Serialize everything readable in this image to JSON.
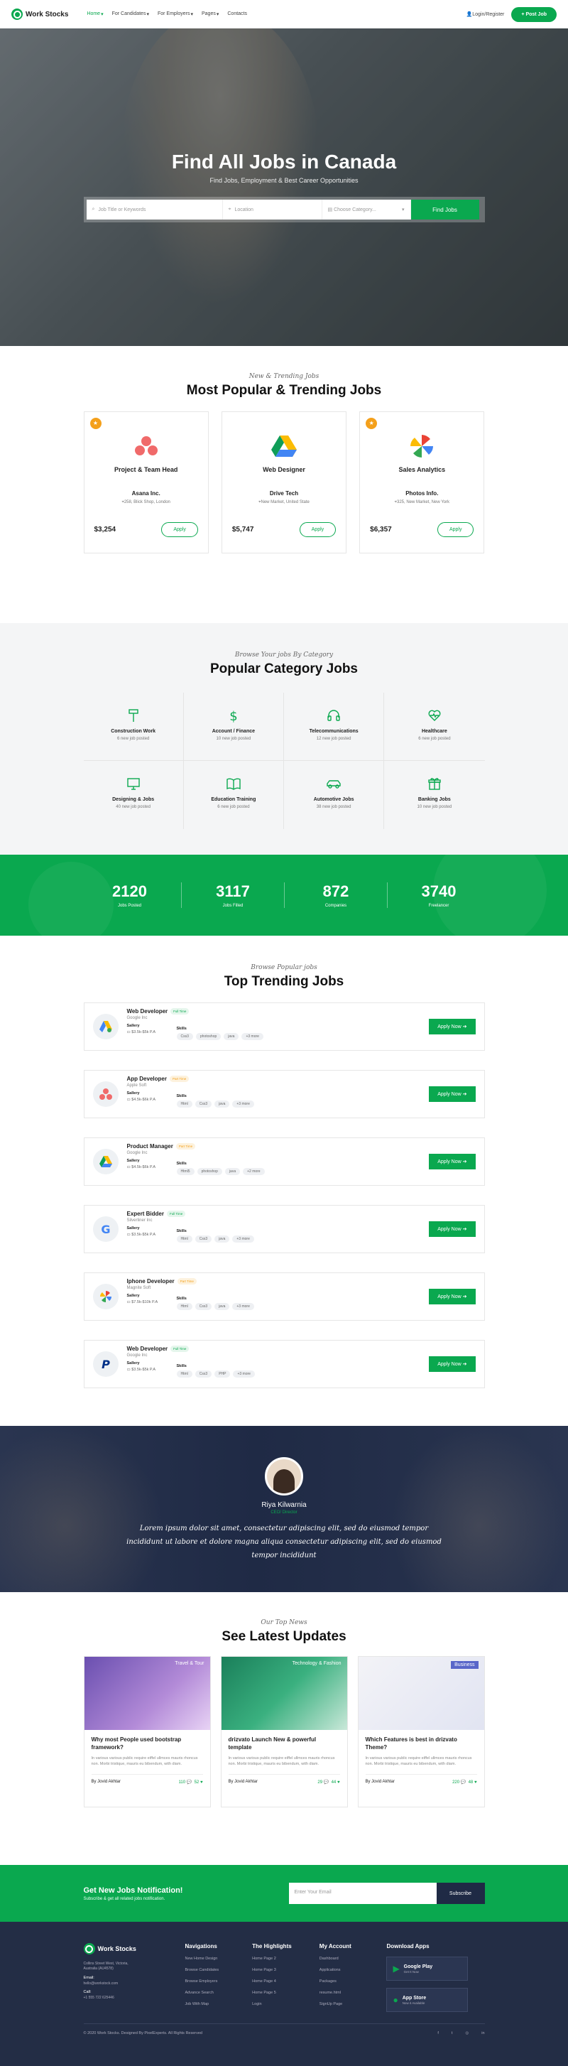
{
  "nav": {
    "brand": "Work Stocks",
    "items": [
      "Home",
      "For Candidates",
      "For Employers",
      "Pages",
      "Contacts"
    ],
    "login": "Login/Register",
    "post_job": "Post Job"
  },
  "hero": {
    "title": "Find All Jobs in Canada",
    "subtitle": "Find Jobs, Employment & Best Career Opportunities",
    "search_placeholder": "Job Title or Keywords",
    "location_placeholder": "Location",
    "category_placeholder": "Choose Category...",
    "button": "Find Jobs"
  },
  "popular": {
    "kicker": "New & Trending Jobs",
    "title": "Most Popular & Trending Jobs",
    "cards": [
      {
        "role": "Project & Team Head",
        "company": "Asana Inc.",
        "location": "258, Blick Shop, London",
        "price": "$3,254",
        "apply": "Apply"
      },
      {
        "role": "Web Designer",
        "company": "Drive Tech",
        "location": "New Market, United State",
        "price": "$5,747",
        "apply": "Apply"
      },
      {
        "role": "Sales Analytics",
        "company": "Photos Info.",
        "location": "325, New Market, New York",
        "price": "$6,357",
        "apply": "Apply"
      }
    ]
  },
  "category": {
    "kicker": "Browse Your jobs By Category",
    "title": "Popular Category Jobs",
    "items": [
      {
        "name": "Construction Work",
        "count": "6 new job posted",
        "icon": "hammer-icon"
      },
      {
        "name": "Account / Finance",
        "count": "10 new job posted",
        "icon": "dollar-icon"
      },
      {
        "name": "Telecommunications",
        "count": "12 new job posted",
        "icon": "headset-icon"
      },
      {
        "name": "Healthcare",
        "count": "6 new job posted",
        "icon": "heartbeat-icon"
      },
      {
        "name": "Designing & Jobs",
        "count": "40 new job posted",
        "icon": "monitor-icon"
      },
      {
        "name": "Education Training",
        "count": "6 new job posted",
        "icon": "book-icon"
      },
      {
        "name": "Automotive Jobs",
        "count": "38 new job posted",
        "icon": "car-icon"
      },
      {
        "name": "Banking Jobs",
        "count": "10 new job posted",
        "icon": "gift-icon"
      }
    ]
  },
  "stats": [
    {
      "num": "2120",
      "label": "Jobs Posted"
    },
    {
      "num": "3117",
      "label": "Jobs Filled"
    },
    {
      "num": "872",
      "label": "Companies"
    },
    {
      "num": "3740",
      "label": "Freelancer"
    }
  ],
  "trending": {
    "kicker": "Browse Popular jobs",
    "title": "Top Trending Jobs",
    "salary_label": "Sallery",
    "skills_label": "Skills",
    "apply": "Apply Now",
    "jobs": [
      {
        "title": "Web Developer",
        "badge": "Full Time",
        "badge_type": "full",
        "company": "Google Inc",
        "salary": "$3.5k-$5k P.A",
        "skills": [
          "Css3",
          "photoshop",
          "java",
          "+3 more"
        ]
      },
      {
        "title": "App Developer",
        "badge": "Part Time",
        "badge_type": "free",
        "company": "Apple Soft",
        "salary": "$4.5k-$6k P.A",
        "skills": [
          "Html",
          "Css3",
          "java",
          "+3 more"
        ]
      },
      {
        "title": "Product Manager",
        "badge": "Part Time",
        "badge_type": "free",
        "company": "Google Inc",
        "salary": "$4.5k-$6k P.A",
        "skills": [
          "Html5",
          "photoshop",
          "java",
          "+2 more"
        ]
      },
      {
        "title": "Expert Bidder",
        "badge": "Full Time",
        "badge_type": "full",
        "company": "Silverliner Inc",
        "salary": "$3.5k-$5k P.A",
        "skills": [
          "Html",
          "Css3",
          "java",
          "+3 more"
        ]
      },
      {
        "title": "Iphone Developer",
        "badge": "Part Time",
        "badge_type": "free",
        "company": "Magnite Soft",
        "salary": "$7.5k-$10k P.A",
        "skills": [
          "Html",
          "Css3",
          "java",
          "+3 more"
        ]
      },
      {
        "title": "Web Developer",
        "badge": "Full Time",
        "badge_type": "full",
        "company": "Google Inc",
        "salary": "$3.5k-$5k P.A",
        "skills": [
          "Html",
          "Css3",
          "PHP",
          "+3 more"
        ]
      }
    ]
  },
  "testimonial": {
    "name": "Riya Kilwarnia",
    "role": "CEO/ Director",
    "quote": "Lorem ipsum dolor sit amet, consectetur adipiscing elit, sed do eiusmod tempor incididunt ut labore et dolore magna aliqua consectetur adipiscing elit, sed do eiusmod tempor incididunt"
  },
  "blog": {
    "kicker": "Our Top News",
    "title": "See Latest Updates",
    "posts": [
      {
        "label": "Travel & Tour",
        "title": "Why most People used bootstrap framework?",
        "text": "In various various public require eiffel ullmces mauris rhoncus non. Morbi tristique, mauris eu bibendum, with diam.",
        "author": "By Jovid Akhtar",
        "comments": "110",
        "likes": "52"
      },
      {
        "label": "Technology & Fashion",
        "title": "drizvato Launch New & powerful template",
        "text": "In various various public require eiffel ullmces mauris rhoncus non. Morbi tristique, mauris eu bibendum, with diam.",
        "author": "By Jovid Akhtar",
        "comments": "29",
        "likes": "44"
      },
      {
        "label": "Business",
        "title": "Which Features is best in drizvato Theme?",
        "text": "In various various public require eiffel ullmces mauris rhoncus non. Morbi tristique, mauris eu bibendum, with diam.",
        "author": "By Jovid Akhtar",
        "comments": "220",
        "likes": "48"
      }
    ]
  },
  "newsletter": {
    "title": "Get New Jobs Notification!",
    "subtitle": "Subscribe & get all related jobs notification.",
    "placeholder": "Enter Your Email",
    "button": "Subscribe"
  },
  "footer": {
    "brand": "Work Stocks",
    "address": "Collins Street West, Victoria, Australia (AU4578)",
    "email_label": "Email:",
    "email": "hello@workstock.com",
    "call_label": "Call:",
    "call": "+1 555 722 625446",
    "cols": [
      {
        "title": "Navigations",
        "links": [
          "New Home Design",
          "Browse Candidates",
          "Browse Employers",
          "Advance Search",
          "Job With Map"
        ]
      },
      {
        "title": "The Highlights",
        "links": [
          "Home Page 2",
          "Home Page 3",
          "Home Page 4",
          "Home Page 5",
          "Login"
        ]
      },
      {
        "title": "My Account",
        "links": [
          "Dashboard",
          "Applications",
          "Packages",
          "resume.html",
          "SignUp Page"
        ]
      }
    ],
    "apps_title": "Download Apps",
    "apps": [
      {
        "name": "Google Play",
        "sub": "Get It Now"
      },
      {
        "name": "App Store",
        "sub": "Now it Available"
      }
    ],
    "copyright": "© 2020 Work Stocks. Designed By PixelExperts. All Rights Reserved"
  },
  "colors": {
    "accent": "#0aa84f",
    "dark": "#232d45",
    "star": "#f4a01b"
  }
}
